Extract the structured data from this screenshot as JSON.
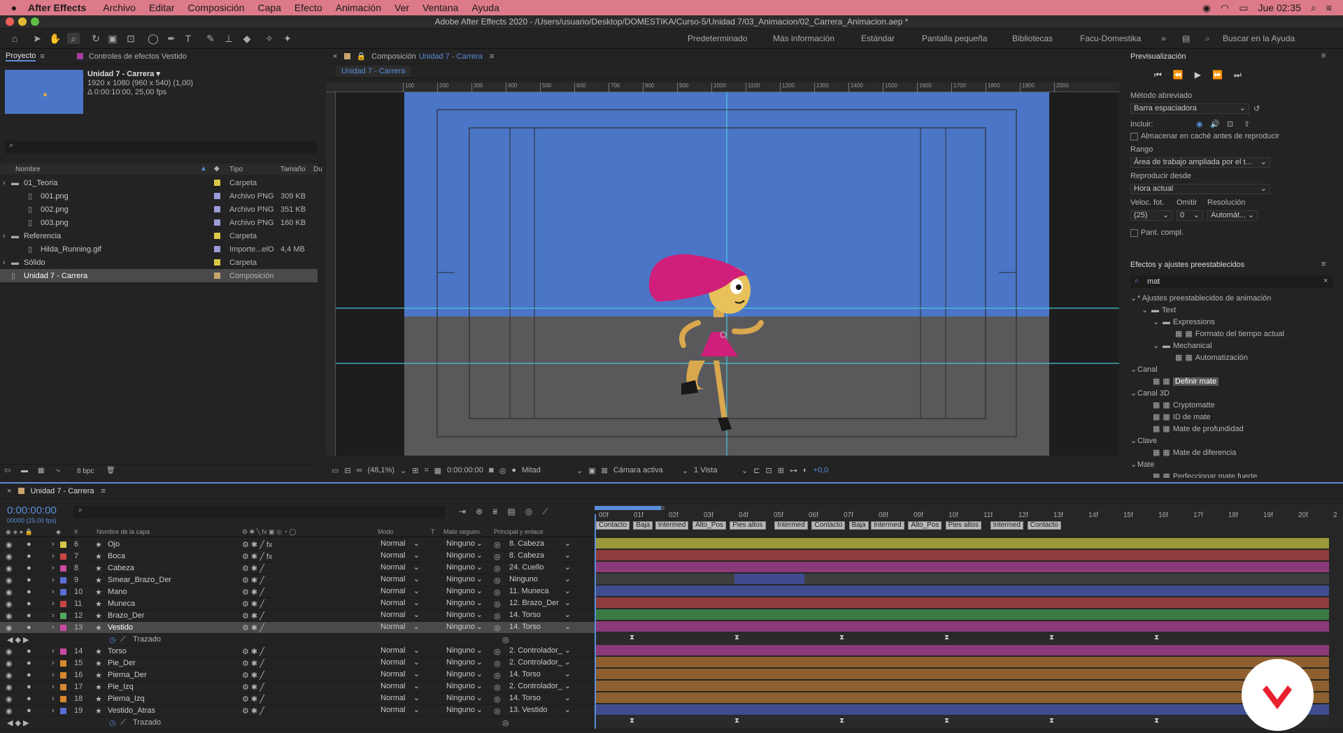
{
  "menubar": {
    "app": "After Effects",
    "items": [
      "Archivo",
      "Editar",
      "Composición",
      "Capa",
      "Efecto",
      "Animación",
      "Ver",
      "Ventana",
      "Ayuda"
    ],
    "clock": "Jue 02:35"
  },
  "window": {
    "title": "Adobe After Effects 2020 - /Users/usuario/Desktop/DOMESTIKA/Curso-5/Unidad 7/03_Animacion/02_Carrera_Animacion.aep *"
  },
  "workspaces": [
    "Predeterminado",
    "Más información",
    "Estándar",
    "Pantalla pequeña",
    "Bibliotecas",
    "Facu-Domestika"
  ],
  "help_search": "Buscar en la Ayuda",
  "project": {
    "tab": "Proyecto",
    "tab2": "Controles de efectos Vestido",
    "comp_name": "Unidad 7 - Carrera ▾",
    "comp_info1": "1920 x 1080  (960 x 540) (1,00)",
    "comp_info2": "Δ 0:00:10:00, 25,00 fps",
    "headers": {
      "name": "Nombre",
      "type": "Tipo",
      "size": "Tamaño",
      "du": "Du"
    },
    "items": [
      {
        "name": "01_Teoria",
        "type": "Carpeta",
        "size": "",
        "color": "#d8c846",
        "indent": 0,
        "folder": true
      },
      {
        "name": "001.png",
        "type": "Archivo PNG",
        "size": "309 KB",
        "color": "#9b9bd8",
        "indent": 1,
        "folder": false
      },
      {
        "name": "002.png",
        "type": "Archivo PNG",
        "size": "351 KB",
        "color": "#9b9bd8",
        "indent": 1,
        "folder": false
      },
      {
        "name": "003.png",
        "type": "Archivo PNG",
        "size": "160 KB",
        "color": "#9b9bd8",
        "indent": 1,
        "folder": false
      },
      {
        "name": "Referencia",
        "type": "Carpeta",
        "size": "",
        "color": "#d8c846",
        "indent": 0,
        "folder": true
      },
      {
        "name": "Hilda_Running.gif",
        "type": "Importe...elO",
        "size": "4,4 MB",
        "color": "#9b9bd8",
        "indent": 1,
        "folder": false
      },
      {
        "name": "Sólido",
        "type": "Carpeta",
        "size": "",
        "color": "#d8c846",
        "indent": 0,
        "folder": true
      },
      {
        "name": "Unidad 7 - Carrera",
        "type": "Composición",
        "size": "",
        "color": "#c8a46e",
        "indent": 0,
        "folder": false
      }
    ],
    "bpc": "8 bpc"
  },
  "composition": {
    "tab_prefix": "Composición",
    "tab_name": "Unidad 7 - Carrera",
    "subtab": "Unidad 7 - Carrera",
    "ruler": [
      "100",
      "200",
      "300",
      "400",
      "500",
      "600",
      "700",
      "800",
      "900",
      "1000",
      "1100",
      "1200",
      "1300",
      "1400",
      "1500",
      "1600",
      "1700",
      "1800",
      "1900",
      "2000"
    ],
    "zoom": "(48,1%)",
    "timecode": "0:00:00:00",
    "resolution": "Mitad",
    "camera": "Cámara activa",
    "views": "1 Vista",
    "exposure": "+0,0"
  },
  "preview": {
    "title": "Previsualización",
    "shortcut_label": "Método abreviado",
    "shortcut": "Barra espaciadora",
    "include": "Incluir:",
    "cache": "Almacenar en caché antes de reproducir",
    "range_label": "Rango",
    "range": "Área de trabajo ampliada por el t...",
    "play_from_label": "Reproducir desde",
    "play_from": "Hora actual",
    "fps_label": "Veloc. fot.",
    "skip_label": "Omitir",
    "res_label": "Resolución",
    "fps": "(25)",
    "skip": "0",
    "res": "Automát...",
    "fullscreen": "Pant. compl."
  },
  "effects": {
    "title": "Efectos y ajustes preestablecidos",
    "search": "mat",
    "tree": [
      {
        "label": "* Ajustes preestablecidos de animación",
        "lvl": 0,
        "kind": "cat"
      },
      {
        "label": "Text",
        "lvl": 1,
        "kind": "folder"
      },
      {
        "label": "Expressions",
        "lvl": 2,
        "kind": "folder"
      },
      {
        "label": "Formato del tiempo actual",
        "lvl": 3,
        "kind": "item"
      },
      {
        "label": "Mechanical",
        "lvl": 2,
        "kind": "folder"
      },
      {
        "label": "Automatización",
        "lvl": 3,
        "kind": "item"
      },
      {
        "label": "Canal",
        "lvl": 0,
        "kind": "cat"
      },
      {
        "label": "Definir mate",
        "lvl": 1,
        "kind": "fx",
        "sel": true
      },
      {
        "label": "Canal 3D",
        "lvl": 0,
        "kind": "cat"
      },
      {
        "label": "Cryptomatte",
        "lvl": 1,
        "kind": "fx"
      },
      {
        "label": "ID de mate",
        "lvl": 1,
        "kind": "fx"
      },
      {
        "label": "Mate de profundidad",
        "lvl": 1,
        "kind": "fx"
      },
      {
        "label": "Clave",
        "lvl": 0,
        "kind": "cat"
      },
      {
        "label": "Mate de diferencia",
        "lvl": 1,
        "kind": "fx"
      },
      {
        "label": "Mate",
        "lvl": 0,
        "kind": "cat"
      },
      {
        "label": "Perfeccionar mate fuerte",
        "lvl": 1,
        "kind": "fx"
      }
    ]
  },
  "timeline": {
    "tab": "Unidad 7 - Carrera",
    "timecode": "0:00:00:00",
    "fps_info": "00000 (25.00 fps)",
    "headers": {
      "layer": "Nombre de la capa",
      "mode": "Modo",
      "t": "T",
      "matte": "Mate seguim.",
      "parent": "Principal y enlace"
    },
    "ticks": [
      "00f",
      "01f",
      "02f",
      "03f",
      "04f",
      "05f",
      "06f",
      "07f",
      "08f",
      "09f",
      "10f",
      "11f",
      "12f",
      "13f",
      "14f",
      "15f",
      "16f",
      "17f",
      "18f",
      "19f",
      "20f",
      "2"
    ],
    "markers": [
      "Contacto",
      "Baja",
      "Intermed",
      "Alto_Pos",
      "Pies altos",
      "Intermed",
      "Contacto",
      "Baja",
      "Intermed",
      "Alto_Pos",
      "Pies altos",
      "Intermed",
      "Contacto"
    ],
    "layers": [
      {
        "num": "6",
        "name": "Ojo",
        "color": "#d8c846",
        "mode": "Normal",
        "matte": "Ninguno",
        "parent": "8. Cabeza",
        "bar": "#9a9a3c",
        "fx": true
      },
      {
        "num": "7",
        "name": "Boca",
        "color": "#c84646",
        "mode": "Normal",
        "matte": "Ninguno",
        "parent": "8. Cabeza",
        "bar": "#8e3d3d",
        "fx": true
      },
      {
        "num": "8",
        "name": "Cabeza",
        "color": "#c84a9e",
        "mode": "Normal",
        "matte": "Ninguno",
        "parent": "24. Cuello",
        "bar": "#8a3a78"
      },
      {
        "num": "9",
        "name": "Smear_Brazo_Der",
        "color": "#5a6ed8",
        "mode": "Normal",
        "matte": "Ninguno",
        "parent": "Ninguno",
        "bar": "#3e3e3e",
        "smear": true
      },
      {
        "num": "10",
        "name": "Mano",
        "color": "#5a6ed8",
        "mode": "Normal",
        "matte": "Ninguno",
        "parent": "11. Muneca",
        "bar": "#3f4c8e"
      },
      {
        "num": "11",
        "name": "Muneca",
        "color": "#c84646",
        "mode": "Normal",
        "matte": "Ninguno",
        "parent": "12. Brazo_Der",
        "bar": "#8e3d3d"
      },
      {
        "num": "12",
        "name": "Brazo_Der",
        "color": "#4eaa5a",
        "mode": "Normal",
        "matte": "Ninguno",
        "parent": "14. Torso",
        "bar": "#3a7a44"
      },
      {
        "num": "13",
        "name": "Vestido",
        "color": "#c84a9e",
        "mode": "Normal",
        "matte": "Ninguno",
        "parent": "14. Torso",
        "bar": "#8a3a78",
        "sel": true
      },
      {
        "num": "",
        "name": "Trazado",
        "sub": true
      },
      {
        "num": "14",
        "name": "Torso",
        "color": "#c84a9e",
        "mode": "Normal",
        "matte": "Ninguno",
        "parent": "2. Controlador_",
        "bar": "#8a3a78"
      },
      {
        "num": "15",
        "name": "Pie_Der",
        "color": "#d8882e",
        "mode": "Normal",
        "matte": "Ninguno",
        "parent": "2. Controlador_",
        "bar": "#8e6030"
      },
      {
        "num": "16",
        "name": "Pierna_Der",
        "color": "#d8882e",
        "mode": "Normal",
        "matte": "Ninguno",
        "parent": "14. Torso",
        "bar": "#8e6030"
      },
      {
        "num": "17",
        "name": "Pie_Izq",
        "color": "#d8882e",
        "mode": "Normal",
        "matte": "Ninguno",
        "parent": "2. Controlador_",
        "bar": "#8e6030"
      },
      {
        "num": "18",
        "name": "Pierna_Izq",
        "color": "#d8882e",
        "mode": "Normal",
        "matte": "Ninguno",
        "parent": "14. Torso",
        "bar": "#8e6030"
      },
      {
        "num": "19",
        "name": "Vestido_Atras",
        "color": "#5a6ed8",
        "mode": "Normal",
        "matte": "Ninguno",
        "parent": "13. Vestido",
        "bar": "#3f4c8e"
      },
      {
        "num": "",
        "name": "Trazado",
        "sub": true
      }
    ]
  }
}
